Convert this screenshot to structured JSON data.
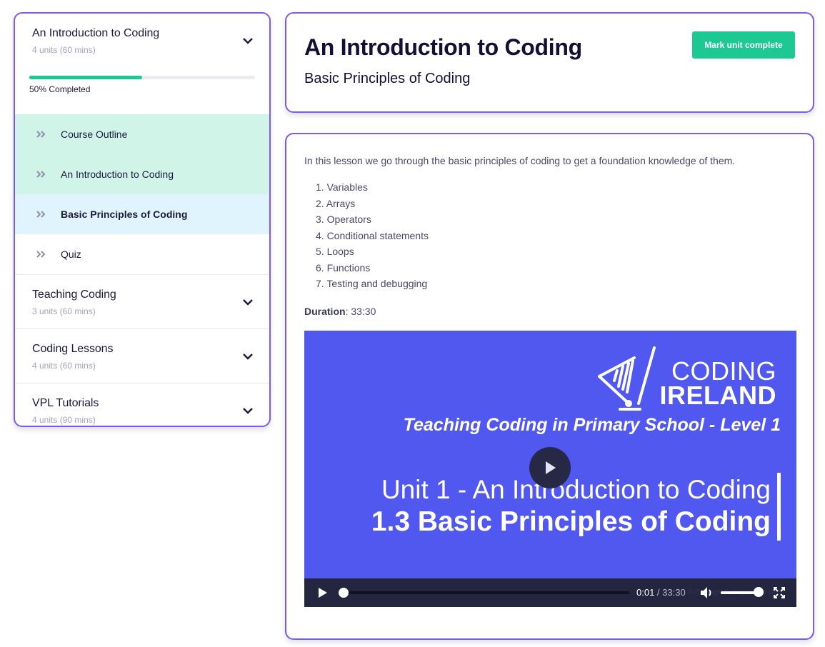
{
  "sidebar": {
    "sections": [
      {
        "title": "An Introduction to Coding",
        "meta": "4 units (60 mins)",
        "expanded": true,
        "progress_percent": 50,
        "progress_label": "50% Completed",
        "lessons": [
          {
            "label": "Course Outline",
            "state": "done"
          },
          {
            "label": "An Introduction to Coding",
            "state": "done"
          },
          {
            "label": "Basic Principles of Coding",
            "state": "active"
          },
          {
            "label": "Quiz",
            "state": "pending"
          }
        ]
      },
      {
        "title": "Teaching Coding",
        "meta": "3 units (60 mins)",
        "expanded": false
      },
      {
        "title": "Coding Lessons",
        "meta": "4 units (60 mins)",
        "expanded": false
      },
      {
        "title": "VPL Tutorials",
        "meta": "4 units (90 mins)",
        "expanded": false
      }
    ]
  },
  "header": {
    "title": "An Introduction to Coding",
    "subtitle": "Basic Principles of Coding",
    "mark_complete_label": "Mark unit complete"
  },
  "content": {
    "intro": "In this lesson we go through the basic principles of coding to get a foundation knowledge of them.",
    "topics": [
      "1. Variables",
      "2. Arrays",
      "3. Operators",
      "4. Conditional statements",
      "5. Loops",
      "6. Functions",
      "7. Testing and debugging"
    ],
    "duration_label": "Duration",
    "duration_value": ": 33:30"
  },
  "video": {
    "brand_line1": "CODING",
    "brand_line2": "IRELAND",
    "tagline": "Teaching Coding in Primary School - Level 1",
    "unit_line": "Unit 1 - An Introduction to Coding",
    "lesson_line": "1.3 Basic Principles of Coding",
    "current_time": "0:01",
    "separator": " / ",
    "total_time": "33:30",
    "watermark": "© Copyright Coding Ireland 20",
    "progress_fraction": 0.0005,
    "volume_fraction": 1.0
  },
  "colors": {
    "accent_border": "#7a5af8",
    "success_green": "#1dc993",
    "video_bg": "#5158ef",
    "controls_bg": "#24263f"
  }
}
